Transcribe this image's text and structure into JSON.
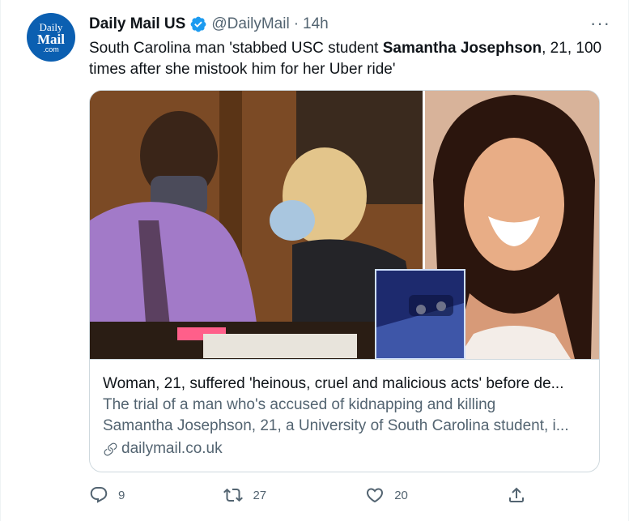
{
  "avatar": {
    "line1": "Daily",
    "line2": "Mail",
    "line3": ".com"
  },
  "header": {
    "name": "Daily Mail US",
    "handle": "@DailyMail",
    "separator": "·",
    "time": "14h",
    "more": "···"
  },
  "tweet": {
    "text_before": "South Carolina man 'stabbed USC student ",
    "text_bold": "Samantha Josephson",
    "text_after": ", 21, 100 times after she mistook him for her Uber ride'"
  },
  "card": {
    "title": "Woman, 21, suffered 'heinous, cruel and malicious acts' before de...",
    "description_line1": "The trial of a man who's accused of kidnapping and killing",
    "description_line2": "Samantha Josephson, 21, a University of South Carolina student, i...",
    "domain": "dailymail.co.uk"
  },
  "actions": {
    "replies": "9",
    "retweets": "27",
    "likes": "20"
  },
  "colors": {
    "brand": "#0b5fb1",
    "verified": "#1d9bf0",
    "text": "#0f1419",
    "secondary": "#536471",
    "border": "#cfd9de"
  }
}
